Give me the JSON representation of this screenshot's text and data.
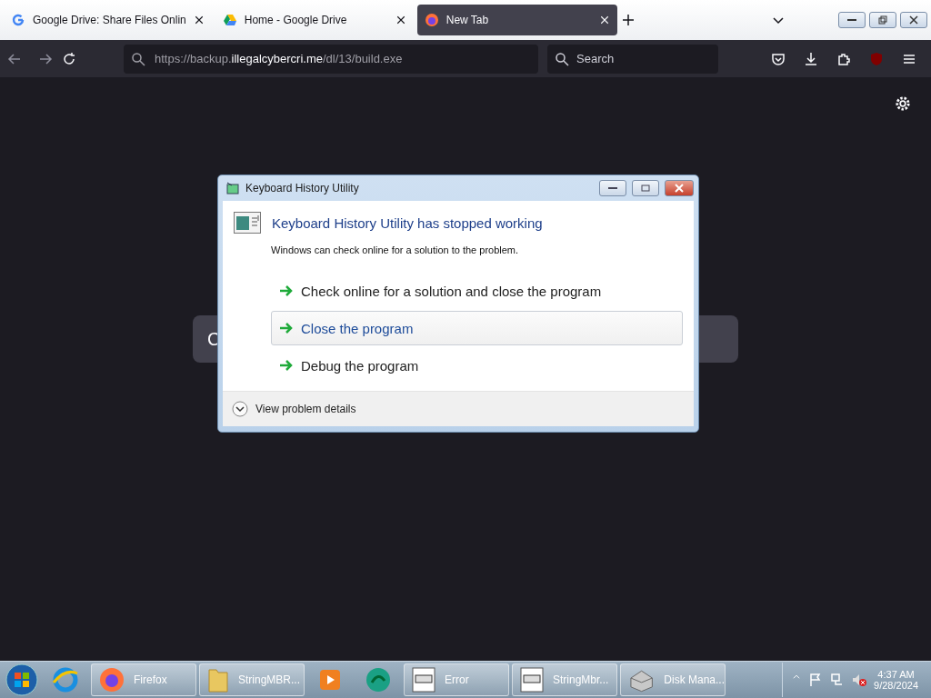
{
  "browser": {
    "tabs": [
      {
        "title": "Google Drive: Share Files Onlin",
        "kind": "google",
        "selected": false
      },
      {
        "title": "Home - Google Drive",
        "kind": "drive",
        "selected": false
      },
      {
        "title": "New Tab",
        "kind": "firefox",
        "selected": true
      }
    ],
    "url": {
      "prefix": "https://backup.",
      "domain": "illegalcybercri.me",
      "suffix": "/dl/13/build.exe"
    },
    "search": {
      "placeholder": "Search"
    },
    "page_card": {
      "text": "C"
    }
  },
  "dialog": {
    "title": "Keyboard History Utility",
    "heading": "Keyboard History Utility has stopped working",
    "message": "Windows can check online for a solution to the problem.",
    "options": [
      {
        "label": "Check online for a solution and close the program",
        "hovered": false
      },
      {
        "label": "Close the program",
        "hovered": true
      },
      {
        "label": "Debug the program",
        "hovered": false
      }
    ],
    "details": "View problem details"
  },
  "taskbar": {
    "items": [
      {
        "kind": "ie"
      },
      {
        "kind": "firefox",
        "label": "Firefox"
      },
      {
        "kind": "folder",
        "label": "StringMBR..."
      },
      {
        "kind": "media"
      },
      {
        "kind": "orb"
      },
      {
        "kind": "window",
        "label": "Error"
      },
      {
        "kind": "window",
        "label": "StringMbr..."
      },
      {
        "kind": "disk",
        "label": "Disk Mana..."
      }
    ],
    "time": "4:37 AM",
    "date": "9/28/2024"
  }
}
